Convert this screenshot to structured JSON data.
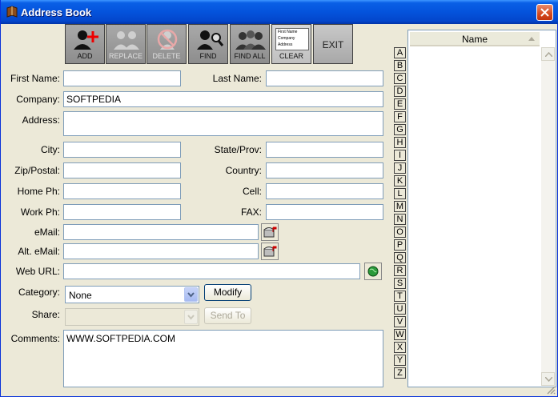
{
  "window": {
    "title": "Address Book"
  },
  "toolbar": {
    "add": "ADD",
    "replace": "REPLACE",
    "delete": "DELETE",
    "find": "FIND",
    "find_all": "FIND ALL",
    "clear": "CLEAR",
    "clear_mini": [
      "First Name",
      "Company",
      "Address"
    ],
    "exit": "EXIT"
  },
  "form": {
    "first_name_label": "First Name:",
    "last_name_label": "Last Name:",
    "company_label": "Company:",
    "company_value": "SOFTPEDIA",
    "address_label": "Address:",
    "city_label": "City:",
    "state_label": "State/Prov:",
    "zip_label": "Zip/Postal:",
    "country_label": "Country:",
    "home_label": "Home Ph:",
    "cell_label": "Cell:",
    "work_label": "Work Ph:",
    "fax_label": "FAX:",
    "email_label": "eMail:",
    "alt_email_label": "Alt. eMail:",
    "web_label": "Web URL:",
    "category_label": "Category:",
    "category_value": "None",
    "modify_label": "Modify",
    "share_label": "Share:",
    "send_to_label": "Send To",
    "comments_label": "Comments:",
    "comments_value": "WWW.SOFTPEDIA.COM"
  },
  "alphabet": [
    "A",
    "B",
    "C",
    "D",
    "E",
    "F",
    "G",
    "H",
    "I",
    "J",
    "K",
    "L",
    "M",
    "N",
    "O",
    "P",
    "Q",
    "R",
    "S",
    "T",
    "U",
    "V",
    "W",
    "X",
    "Y",
    "Z"
  ],
  "list": {
    "header": "Name"
  }
}
